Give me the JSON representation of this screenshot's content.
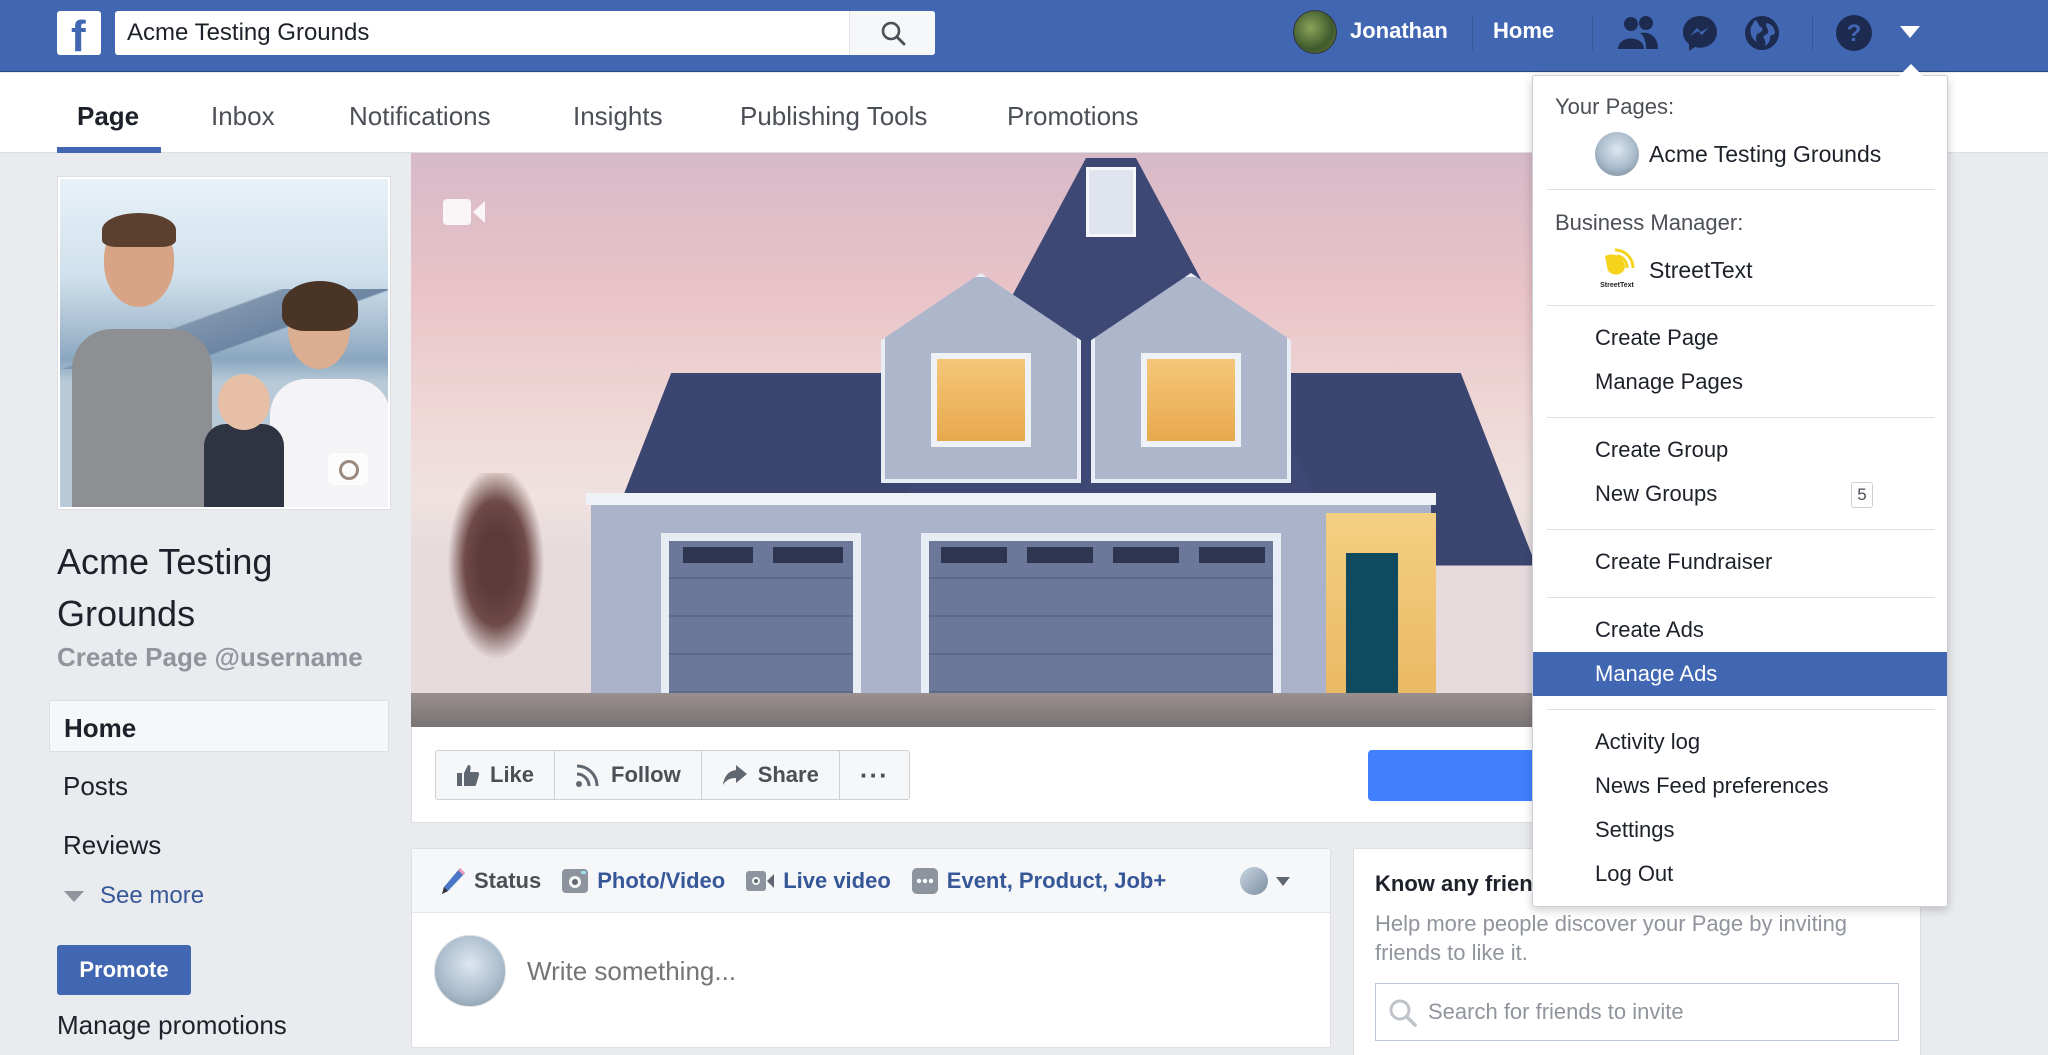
{
  "topbar": {
    "logo": "f",
    "search_value": "Acme Testing Grounds",
    "user_name": "Jonathan",
    "home_label": "Home",
    "icons": [
      "friend-requests-icon",
      "messenger-icon",
      "notifications-globe-icon",
      "help-icon",
      "account-menu-caret-icon"
    ]
  },
  "page_tabs": [
    {
      "label": "Page",
      "active": true
    },
    {
      "label": "Inbox",
      "active": false
    },
    {
      "label": "Notifications",
      "active": false
    },
    {
      "label": "Insights",
      "active": false
    },
    {
      "label": "Publishing Tools",
      "active": false
    },
    {
      "label": "Promotions",
      "active": false
    }
  ],
  "left": {
    "page_name": "Acme Testing Grounds",
    "username_link": "Create Page @username",
    "nav": [
      {
        "label": "Home",
        "active": true
      },
      {
        "label": "Posts",
        "active": false
      },
      {
        "label": "Reviews",
        "active": false
      }
    ],
    "see_more": "See more",
    "promote_label": "Promote",
    "manage_promotions": "Manage promotions"
  },
  "actions": {
    "like": "Like",
    "follow": "Follow",
    "share": "Share",
    "more": "···"
  },
  "composer": {
    "tabs": [
      {
        "label": "Status",
        "icon": "pencil-icon",
        "active": true
      },
      {
        "label": "Photo/Video",
        "icon": "camera-icon",
        "active": false
      },
      {
        "label": "Live video",
        "icon": "live-video-icon",
        "active": false
      },
      {
        "label": "Event, Product, Job+",
        "icon": "more-options-icon",
        "active": false
      }
    ],
    "placeholder": "Write something..."
  },
  "invite": {
    "title": "Know any friends who might like this Page?",
    "description": "Help more people discover your Page by inviting friends to like it.",
    "search_placeholder": "Search for friends to invite"
  },
  "dropdown": {
    "your_pages_header": "Your Pages:",
    "your_pages": [
      {
        "label": "Acme Testing Grounds"
      }
    ],
    "business_manager_header": "Business Manager:",
    "business_managers": [
      {
        "label": "StreetText",
        "logo_text": "StreetText"
      }
    ],
    "items_group1": [
      {
        "label": "Create Page"
      },
      {
        "label": "Manage Pages"
      }
    ],
    "items_group2": [
      {
        "label": "Create Group"
      },
      {
        "label": "New Groups",
        "badge": "5"
      }
    ],
    "items_group3": [
      {
        "label": "Create Fundraiser"
      }
    ],
    "items_group4": [
      {
        "label": "Create Ads"
      },
      {
        "label": "Manage Ads",
        "highlighted": true
      }
    ],
    "items_group5": [
      {
        "label": "Activity log"
      },
      {
        "label": "News Feed preferences"
      },
      {
        "label": "Settings"
      },
      {
        "label": "Log Out"
      }
    ]
  },
  "colors": {
    "brand_blue": "#4267b2",
    "link_blue": "#365899",
    "cta_blue": "#4080ff",
    "page_bg": "#e9ebee"
  }
}
